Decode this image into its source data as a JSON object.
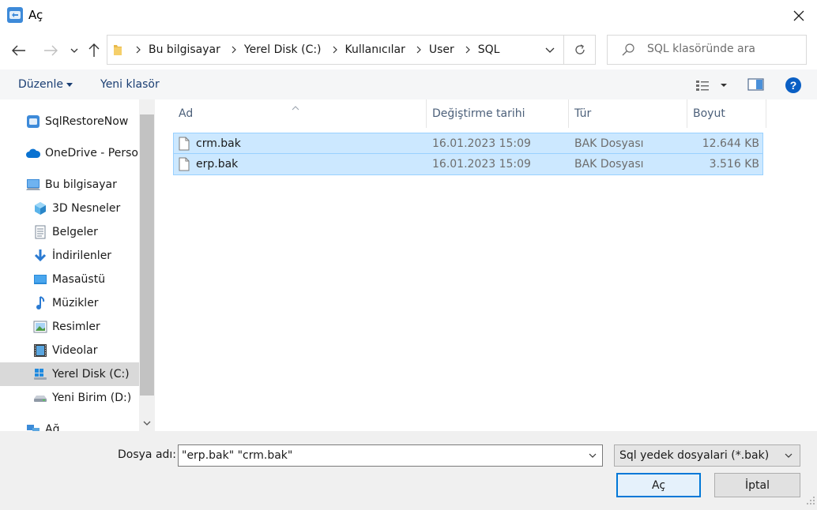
{
  "window": {
    "title": "Aç",
    "close_glyph": "✕"
  },
  "nav": {
    "back_icon": "arrow-left-icon",
    "forward_icon": "arrow-right-icon",
    "recent_icon": "chevron-down-icon",
    "up_icon": "arrow-up-icon"
  },
  "address": {
    "crumbs": [
      "Bu bilgisayar",
      "Yerel Disk (C:)",
      "Kullanıcılar",
      "User",
      "SQL"
    ]
  },
  "search": {
    "placeholder": "SQL klasöründe ara"
  },
  "toolbar": {
    "organize_label": "Düzenle",
    "new_folder_label": "Yeni klasör"
  },
  "sidebar": {
    "items": [
      {
        "label": "SqlRestoreNow",
        "icon": "app-icon"
      },
      {
        "label": "OneDrive - Person",
        "icon": "cloud-icon"
      },
      {
        "label": "Bu bilgisayar",
        "icon": "computer-icon"
      },
      {
        "label": "3D Nesneler",
        "icon": "cube-icon"
      },
      {
        "label": "Belgeler",
        "icon": "document-icon"
      },
      {
        "label": "İndirilenler",
        "icon": "download-icon"
      },
      {
        "label": "Masaüstü",
        "icon": "desktop-icon"
      },
      {
        "label": "Müzikler",
        "icon": "music-icon"
      },
      {
        "label": "Resimler",
        "icon": "picture-icon"
      },
      {
        "label": "Videolar",
        "icon": "video-icon"
      },
      {
        "label": "Yerel Disk (C:)",
        "icon": "drive-icon"
      },
      {
        "label": "Yeni Birim (D:)",
        "icon": "drive-icon"
      },
      {
        "label": "Ağ",
        "icon": "network-icon"
      }
    ],
    "selected_index": 10
  },
  "filelist": {
    "columns": [
      "Ad",
      "Değiştirme tarihi",
      "Tür",
      "Boyut"
    ],
    "sort_column": "Ad",
    "rows": [
      {
        "name": "crm.bak",
        "modified": "16.01.2023 15:09",
        "type": "BAK Dosyası",
        "size": "12.644 KB",
        "selected": true
      },
      {
        "name": "erp.bak",
        "modified": "16.01.2023 15:09",
        "type": "BAK Dosyası",
        "size": "3.516 KB",
        "selected": true
      }
    ]
  },
  "footer": {
    "filename_label": "Dosya adı:",
    "filename_value": "\"erp.bak\" \"crm.bak\"",
    "filter_value": "Sql yedek dosyalari (*.bak)",
    "open_label": "Aç",
    "cancel_label": "İptal"
  },
  "colors": {
    "accent": "#0078d7",
    "selection": "#cce8ff",
    "selection_border": "#99d1ff",
    "link": "#1a3e73"
  }
}
